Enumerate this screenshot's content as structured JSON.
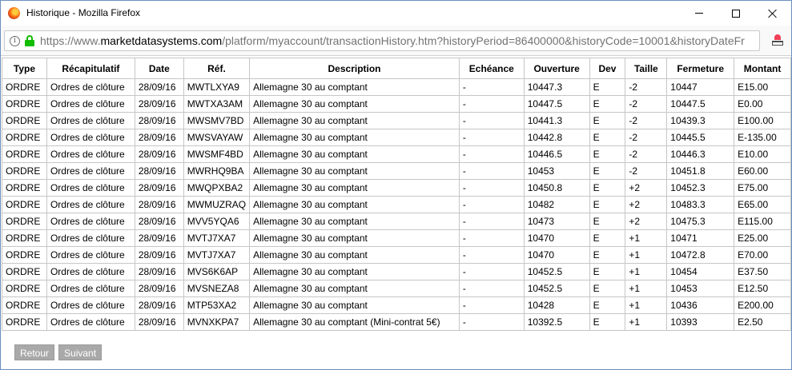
{
  "window": {
    "title": "Historique - Mozilla Firefox"
  },
  "urlbar": {
    "prefix": "https://www.",
    "host": "marketdatasystems.com",
    "path": "/platform/myaccount/transactionHistory.htm?historyPeriod=86400000&historyCode=10001&historyDateFr"
  },
  "table": {
    "headers": [
      "Type",
      "Récapitulatif",
      "Date",
      "Réf.",
      "Description",
      "Echéance",
      "Ouverture",
      "Dev",
      "Taille",
      "Fermeture",
      "Montant"
    ],
    "rows": [
      [
        "ORDRE",
        "Ordres de clôture",
        "28/09/16",
        "MWTLXYA9",
        "Allemagne 30 au comptant",
        "-",
        "10447.3",
        "E",
        "-2",
        "10447",
        "E15.00"
      ],
      [
        "ORDRE",
        "Ordres de clôture",
        "28/09/16",
        "MWTXA3AM",
        "Allemagne 30 au comptant",
        "-",
        "10447.5",
        "E",
        "-2",
        "10447.5",
        "E0.00"
      ],
      [
        "ORDRE",
        "Ordres de clôture",
        "28/09/16",
        "MWSMV7BD",
        "Allemagne 30 au comptant",
        "-",
        "10441.3",
        "E",
        "-2",
        "10439.3",
        "E100.00"
      ],
      [
        "ORDRE",
        "Ordres de clôture",
        "28/09/16",
        "MWSVAYAW",
        "Allemagne 30 au comptant",
        "-",
        "10442.8",
        "E",
        "-2",
        "10445.5",
        "E-135.00"
      ],
      [
        "ORDRE",
        "Ordres de clôture",
        "28/09/16",
        "MWSMF4BD",
        "Allemagne 30 au comptant",
        "-",
        "10446.5",
        "E",
        "-2",
        "10446.3",
        "E10.00"
      ],
      [
        "ORDRE",
        "Ordres de clôture",
        "28/09/16",
        "MWRHQ9BA",
        "Allemagne 30 au comptant",
        "-",
        "10453",
        "E",
        "-2",
        "10451.8",
        "E60.00"
      ],
      [
        "ORDRE",
        "Ordres de clôture",
        "28/09/16",
        "MWQPXBA2",
        "Allemagne 30 au comptant",
        "-",
        "10450.8",
        "E",
        "+2",
        "10452.3",
        "E75.00"
      ],
      [
        "ORDRE",
        "Ordres de clôture",
        "28/09/16",
        "MWMUZRAQ",
        "Allemagne 30 au comptant",
        "-",
        "10482",
        "E",
        "+2",
        "10483.3",
        "E65.00"
      ],
      [
        "ORDRE",
        "Ordres de clôture",
        "28/09/16",
        "MVV5YQA6",
        "Allemagne 30 au comptant",
        "-",
        "10473",
        "E",
        "+2",
        "10475.3",
        "E115.00"
      ],
      [
        "ORDRE",
        "Ordres de clôture",
        "28/09/16",
        "MVTJ7XA7",
        "Allemagne 30 au comptant",
        "-",
        "10470",
        "E",
        "+1",
        "10471",
        "E25.00"
      ],
      [
        "ORDRE",
        "Ordres de clôture",
        "28/09/16",
        "MVTJ7XA7",
        "Allemagne 30 au comptant",
        "-",
        "10470",
        "E",
        "+1",
        "10472.8",
        "E70.00"
      ],
      [
        "ORDRE",
        "Ordres de clôture",
        "28/09/16",
        "MVS6K6AP",
        "Allemagne 30 au comptant",
        "-",
        "10452.5",
        "E",
        "+1",
        "10454",
        "E37.50"
      ],
      [
        "ORDRE",
        "Ordres de clôture",
        "28/09/16",
        "MVSNEZA8",
        "Allemagne 30 au comptant",
        "-",
        "10452.5",
        "E",
        "+1",
        "10453",
        "E12.50"
      ],
      [
        "ORDRE",
        "Ordres de clôture",
        "28/09/16",
        "MTP53XA2",
        "Allemagne 30 au comptant",
        "-",
        "10428",
        "E",
        "+1",
        "10436",
        "E200.00"
      ],
      [
        "ORDRE",
        "Ordres de clôture",
        "28/09/16",
        "MVNXKPA7",
        "Allemagne 30 au comptant (Mini-contrat 5€)",
        "-",
        "10392.5",
        "E",
        "+1",
        "10393",
        "E2.50"
      ]
    ]
  },
  "pager": {
    "prev_label": "Retour",
    "next_label": "Suivant"
  }
}
